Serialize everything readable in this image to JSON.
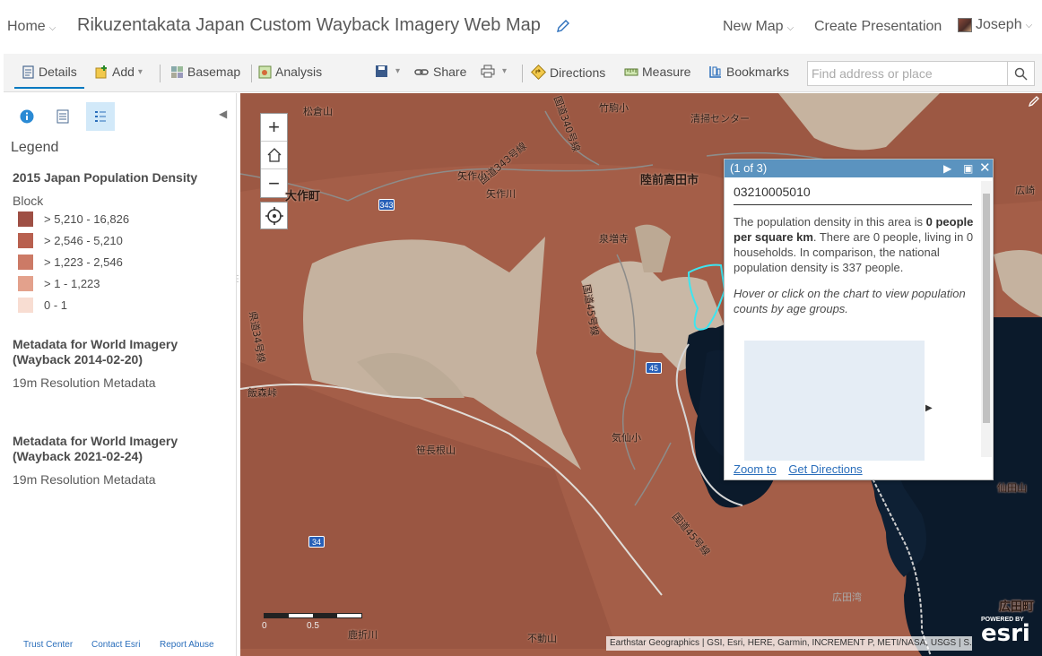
{
  "header": {
    "home_label": "Home",
    "title": "Rikuzentakata Japan Custom Wayback Imagery Web Map",
    "new_map_label": "New Map",
    "create_presentation_label": "Create Presentation",
    "user_name": "Joseph"
  },
  "toolbar": {
    "details_label": "Details",
    "add_label": "Add",
    "basemap_label": "Basemap",
    "analysis_label": "Analysis",
    "share_label": "Share",
    "directions_label": "Directions",
    "measure_label": "Measure",
    "bookmarks_label": "Bookmarks",
    "search_placeholder": "Find address or place"
  },
  "legend": {
    "heading": "Legend",
    "layer1_title": "2015 Japan Population Density",
    "layer1_sublabel": "Block",
    "classes": [
      {
        "label": "> 5,210 - 16,826",
        "color": "#9e4f44"
      },
      {
        "label": "> 2,546 - 5,210",
        "color": "#b8604f"
      },
      {
        "label": "> 1,223 - 2,546",
        "color": "#cc7a66"
      },
      {
        "label": "> 1 - 1,223",
        "color": "#e3a18c"
      },
      {
        "label": "0 - 1",
        "color": "#f8ddd2"
      }
    ],
    "layer2_title_line1": "Metadata for World Imagery",
    "layer2_title_line2": "(Wayback 2014-02-20)",
    "layer2_sublabel": "19m Resolution Metadata",
    "layer3_title_line1": "Metadata for World Imagery",
    "layer3_title_line2": "(Wayback 2021-02-24)",
    "layer3_sublabel": "19m Resolution Metadata"
  },
  "footer": {
    "trust_center": "Trust Center",
    "contact_esri": "Contact Esri",
    "report_abuse": "Report Abuse"
  },
  "map": {
    "labels": {
      "matsukura": "松倉山",
      "takeyama": "竹駒小",
      "seiso": "清掃センター",
      "kokudo340": "国道340号線",
      "kokudo343": "国道343号線",
      "yasakusho": "矢作小",
      "yasakugawa": "矢作川",
      "osakucho": "大作町",
      "rikuzen": "陸前高田市",
      "sengaku": "泉増寺",
      "kokudo45a": "国道45号線",
      "kokudo45b": "国道45号線",
      "kokudo34": "県道34号線",
      "iidoge": "飯森峠",
      "sasanagane": "笹長根山",
      "kesenshou": "気仙小",
      "hirota_bay": "広田湾",
      "hirota_town": "広田町",
      "fudo": "不動山",
      "kanoin": "鹿折川",
      "sendayama": "仙田山",
      "hirosaki": "広崎"
    },
    "shields": {
      "r343": "343",
      "r45": "45",
      "r34": "34"
    },
    "scale_zero": "0",
    "scale_half": "0.5",
    "attribution": "Earthstar Geographics | GSI, Esri, HERE, Garmin, INCREMENT P, METI/NASA, USGS | S...",
    "esri_powered": "POWERED BY",
    "esri_logo": "esri"
  },
  "popup": {
    "counter": "(1 of 3)",
    "id": "03210005010",
    "desc_part1": "The population density in this area is ",
    "desc_bold": "0 people per square km",
    "desc_part2": ". There are 0 people, living in 0 households. In comparison, the national population density is 337 people.",
    "hint": "Hover or click on the chart to view population counts by age groups.",
    "zoom_to": "Zoom to",
    "get_directions": "Get Directions"
  }
}
